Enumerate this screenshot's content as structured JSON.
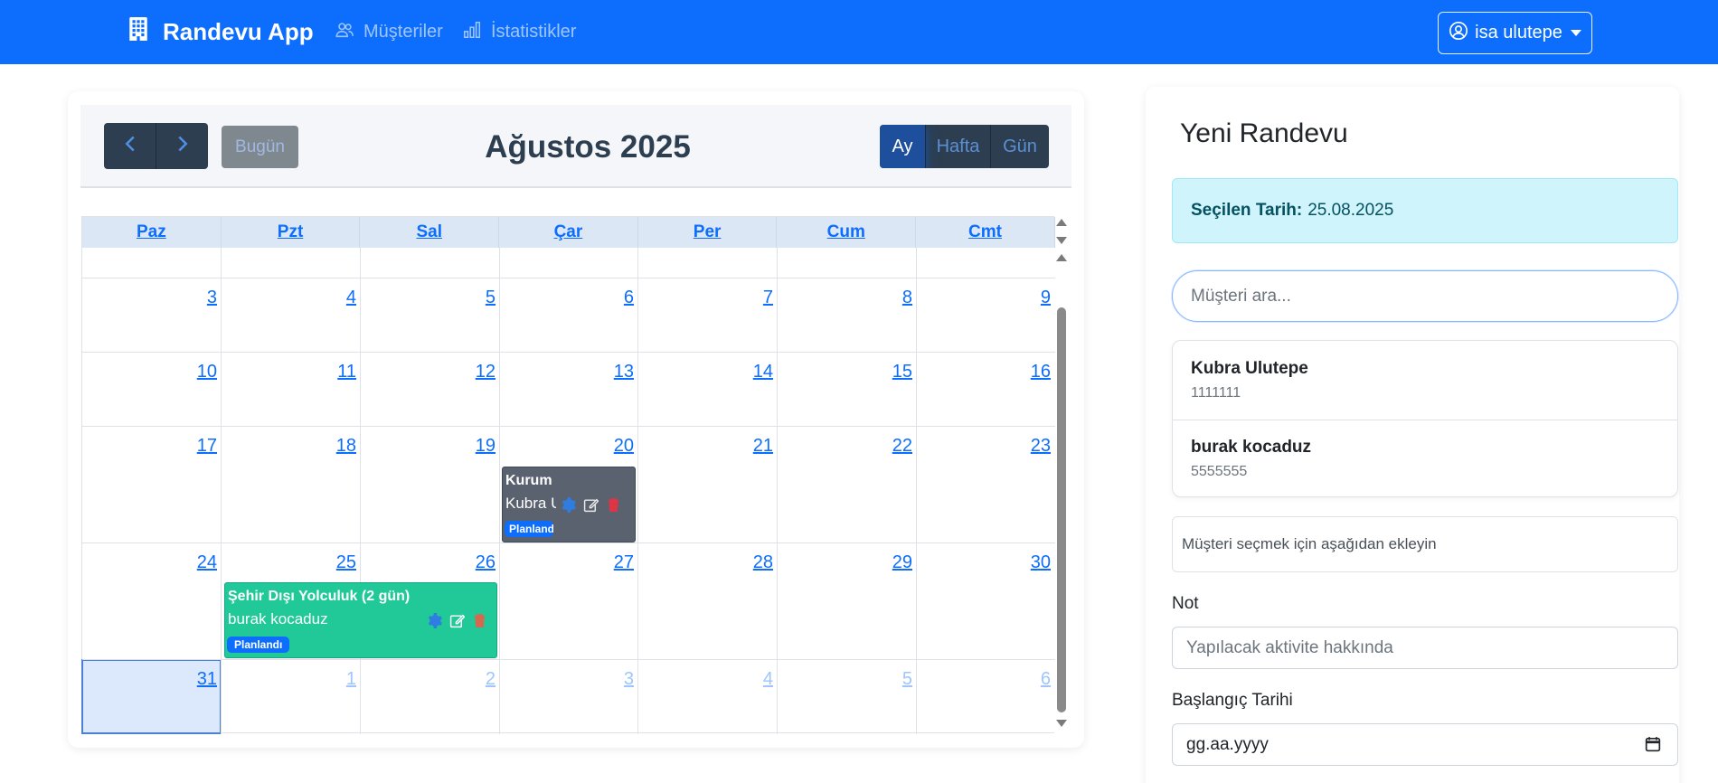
{
  "navbar": {
    "brand": "Randevu App",
    "links": [
      {
        "label": "Müşteriler",
        "icon": "people-icon"
      },
      {
        "label": "İstatistikler",
        "icon": "bar-chart-icon"
      }
    ],
    "user": "isa ulutepe",
    "color": "#0d6efd"
  },
  "calendar": {
    "title": "Ağustos 2025",
    "today_label": "Bugün",
    "views": [
      {
        "label": "Ay",
        "active": true
      },
      {
        "label": "Hafta",
        "active": false
      },
      {
        "label": "Gün",
        "active": false
      }
    ],
    "weekdays": [
      "Paz",
      "Pzt",
      "Sal",
      "Çar",
      "Per",
      "Cum",
      "Cmt"
    ],
    "weeks": [
      [
        {
          "day": "3",
          "other": false
        },
        {
          "day": "4",
          "other": false
        },
        {
          "day": "5",
          "other": false
        },
        {
          "day": "6",
          "other": false
        },
        {
          "day": "7",
          "other": false
        },
        {
          "day": "8",
          "other": false
        },
        {
          "day": "9",
          "other": false
        }
      ],
      [
        {
          "day": "10",
          "other": false
        },
        {
          "day": "11",
          "other": false
        },
        {
          "day": "12",
          "other": false
        },
        {
          "day": "13",
          "other": false
        },
        {
          "day": "14",
          "other": false
        },
        {
          "day": "15",
          "other": false
        },
        {
          "day": "16",
          "other": false
        }
      ],
      [
        {
          "day": "17",
          "other": false
        },
        {
          "day": "18",
          "other": false
        },
        {
          "day": "19",
          "other": false
        },
        {
          "day": "20",
          "other": false
        },
        {
          "day": "21",
          "other": false
        },
        {
          "day": "22",
          "other": false
        },
        {
          "day": "23",
          "other": false
        }
      ],
      [
        {
          "day": "24",
          "other": false
        },
        {
          "day": "25",
          "other": false
        },
        {
          "day": "26",
          "other": false
        },
        {
          "day": "27",
          "other": false
        },
        {
          "day": "28",
          "other": false
        },
        {
          "day": "29",
          "other": false
        },
        {
          "day": "30",
          "other": false
        }
      ],
      [
        {
          "day": "31",
          "other": false,
          "today": true
        },
        {
          "day": "1",
          "other": true
        },
        {
          "day": "2",
          "other": true
        },
        {
          "day": "3",
          "other": true
        },
        {
          "day": "4",
          "other": true
        },
        {
          "day": "5",
          "other": true
        },
        {
          "day": "6",
          "other": true
        }
      ]
    ],
    "events": [
      {
        "title": "Kurum",
        "customer": "Kubra U",
        "status": "Planlandı",
        "color": "#5a6270",
        "date": "20"
      },
      {
        "title": "Şehir Dışı Yolculuk (2 gün)",
        "customer": "burak kocaduz",
        "status": "Planlandı",
        "color": "#20c997",
        "date": "25-26"
      }
    ]
  },
  "panel": {
    "title": "Yeni Randevu",
    "selected_label": "Seçilen Tarih:",
    "selected_value": "25.08.2025",
    "search_placeholder": "Müşteri ara...",
    "customers": [
      {
        "name": "Kubra Ulutepe",
        "phone": "1111111"
      },
      {
        "name": "burak kocaduz",
        "phone": "5555555"
      }
    ],
    "hint": "Müşteri seçmek için aşağıdan ekleyin",
    "note_label": "Not",
    "note_placeholder": "Yapılacak aktivite hakkında",
    "start_label": "Başlangıç Tarihi",
    "start_placeholder": "gg.aa.yyyy"
  }
}
